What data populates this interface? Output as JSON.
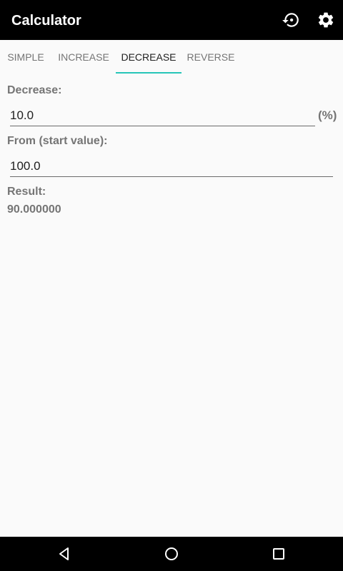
{
  "appbar": {
    "title": "Calculator",
    "icons": [
      "history-icon",
      "settings-icon"
    ]
  },
  "tabs": [
    {
      "label": "SIMPLE",
      "active": false
    },
    {
      "label": "INCREASE",
      "active": false
    },
    {
      "label": "DECREASE",
      "active": true
    },
    {
      "label": "REVERSE",
      "active": false
    }
  ],
  "form": {
    "decrease_label": "Decrease:",
    "decrease_value": "10.0",
    "decrease_unit": "(%)",
    "from_label": "From (start value):",
    "from_value": "100.0",
    "result_label": "Result:",
    "result_value": "90.000000"
  },
  "navbar": {
    "buttons": [
      "back-icon",
      "home-icon",
      "recents-icon"
    ]
  },
  "colors": {
    "appbar": "#000000",
    "accent": "#26c6b8",
    "background": "#fafafa"
  }
}
